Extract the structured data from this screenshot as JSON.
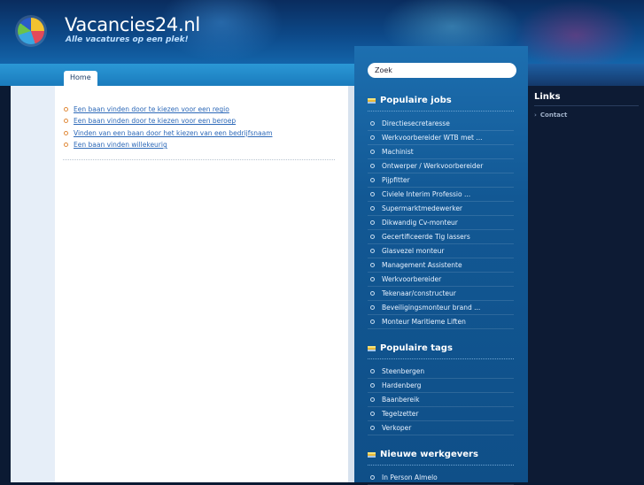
{
  "header": {
    "title": "Vacancies24.nl",
    "tagline": "Alle vacatures op een plek!",
    "logo_icon": "globe-logo-icon"
  },
  "nav": {
    "home": "Home"
  },
  "content": {
    "links": [
      "Een baan vinden door te kiezen voor een regio",
      "Een baan vinden door te kiezen voor een beroep",
      "Vinden van een baan door het kiezen van een bedrijfsnaam",
      "Een baan vinden willekeurig"
    ]
  },
  "sidebar": {
    "search": {
      "value": "Zoek"
    },
    "popular_jobs": {
      "title": "Populaire jobs",
      "items": [
        "Directiesecretaresse",
        "Werkvoorbereider WTB met ...",
        "Machinist",
        "Ontwerper / Werkvoorbereider",
        "Pijpfitter",
        "Civiele Interim Professio ...",
        "Supermarktmedewerker",
        "Dikwandig Cv-monteur",
        "Gecertificeerde Tig lassers",
        "Glasvezel monteur",
        "Management Assistente",
        "Werkvoorbereider",
        "Tekenaar/constructeur",
        "Beveiligingsmonteur brand ...",
        "Monteur Maritieme Liften"
      ]
    },
    "popular_tags": {
      "title": "Populaire tags",
      "items": [
        "Steenbergen",
        "Hardenberg",
        "Baanbereik",
        "Tegelzetter",
        "Verkoper"
      ]
    },
    "new_employers": {
      "title": "Nieuwe werkgevers",
      "items": [
        "In Person Almelo"
      ]
    }
  },
  "right": {
    "links_title": "Links",
    "contact": "Contact"
  }
}
